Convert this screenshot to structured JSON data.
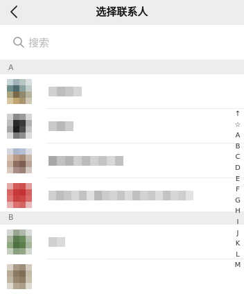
{
  "header": {
    "title": "选择联系人",
    "back_icon": "chevron-left-icon"
  },
  "search": {
    "placeholder": "搜索",
    "icon": "search-icon"
  },
  "sections": [
    {
      "letter": "A"
    },
    {
      "letter": "B"
    }
  ],
  "index_bar": [
    "↑",
    "☆",
    "A",
    "B",
    "C",
    "D",
    "E",
    "F",
    "G",
    "H",
    "I",
    "J",
    "K",
    "L",
    "M"
  ],
  "colors": {
    "background": "#ededed",
    "surface": "#ffffff",
    "placeholder": "#b5b5b5",
    "section_text": "#777777"
  }
}
